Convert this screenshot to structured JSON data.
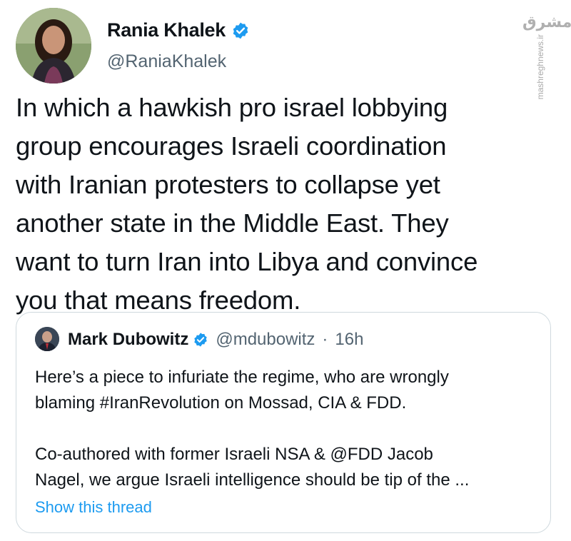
{
  "author": {
    "name": "Rania Khalek",
    "handle": "@RaniaKhalek",
    "verified": true
  },
  "tweet_text": "In which a hawkish pro israel lobbying\ngroup encourages Israeli coordination\nwith Iranian protesters to collapse yet\nanother state in the Middle East. They\nwant to turn Iran into Libya and convince\nyou that means freedom.",
  "quoted_tweet": {
    "name": "Mark Dubowitz",
    "handle": "@mdubowitz",
    "separator": "·",
    "time": "16h",
    "verified": true,
    "text": "Here’s a piece to infuriate the regime, who are wrongly\nblaming #IranRevolution on Mossad, CIA & FDD.\n\nCo-authored with former Israeli NSA & @FDD Jacob\nNagel, we argue Israeli intelligence should be tip of the ...",
    "show_thread": "Show this thread"
  },
  "watermark": {
    "logo": "مشرق",
    "site": "mashreghnews.ir"
  },
  "colors": {
    "verified": "#1d9bf0",
    "link": "#1d9bf0",
    "muted": "#536471",
    "border": "#cfd9de"
  },
  "icons": [
    "verified-badge-icon",
    "avatar-photo"
  ]
}
